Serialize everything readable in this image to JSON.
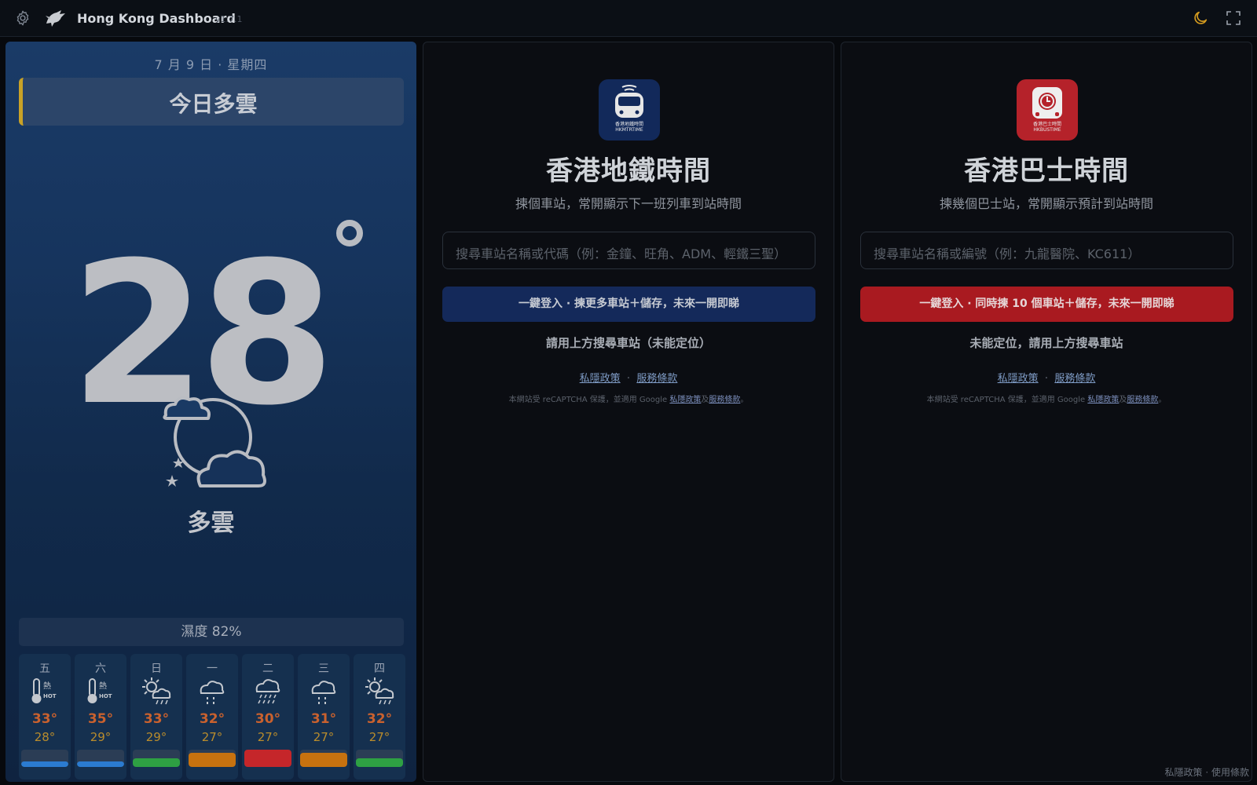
{
  "header": {
    "title": "Hong Kong Dashboard",
    "version": "v1.7.1",
    "icons": [
      "gear-icon",
      "logo-icon",
      "moon-icon",
      "fullscreen-icon"
    ]
  },
  "weather": {
    "date": "7 月 9 日 · 星期四",
    "banner": "今日多雲",
    "temperature": "28",
    "condition": "多雲",
    "condition_icon": "cloudy-night-icon",
    "humidity": "濕度 82%",
    "forecast": [
      {
        "dow": "五",
        "icon": "hot-icon",
        "hi": "33°",
        "lo": "28°",
        "bar_color": "#2b7bd0",
        "bar_level": 0.3
      },
      {
        "dow": "六",
        "icon": "hot-icon",
        "hi": "35°",
        "lo": "29°",
        "bar_color": "#2b7bd0",
        "bar_level": 0.3
      },
      {
        "dow": "日",
        "icon": "sun-shower-icon",
        "hi": "33°",
        "lo": "29°",
        "bar_color": "#2ea043",
        "bar_level": 0.5
      },
      {
        "dow": "一",
        "icon": "shower-icon",
        "hi": "32°",
        "lo": "27°",
        "bar_color": "#c7720f",
        "bar_level": 0.8
      },
      {
        "dow": "二",
        "icon": "heavy-rain-icon",
        "hi": "30°",
        "lo": "27°",
        "bar_color": "#c5262a",
        "bar_level": 1.0
      },
      {
        "dow": "三",
        "icon": "shower-icon",
        "hi": "31°",
        "lo": "27°",
        "bar_color": "#c7720f",
        "bar_level": 0.8
      },
      {
        "dow": "四",
        "icon": "sun-shower-icon",
        "hi": "32°",
        "lo": "27°",
        "bar_color": "#2ea043",
        "bar_level": 0.5
      }
    ]
  },
  "mtr": {
    "icon": "train-icon",
    "icon_caption_1": "香港地鐵時間",
    "icon_caption_2": "HKMTRTIME",
    "title": "香港地鐵時間",
    "subtitle": "揀個車站，常開顯示下一班列車到站時間",
    "search_placeholder": "搜尋車站名稱或代碼（例：金鐘、旺角、ADM、輕鐵三聖）",
    "button": "一鍵登入 · 揀更多車站＋儲存，未來一開即睇",
    "status": "請用上方搜尋車站（未能定位）",
    "privacy": "私隱政策",
    "terms": "服務條款",
    "recaptcha_prefix": "本網站受 reCAPTCHA 保護，並適用 Google ",
    "recaptcha_privacy": "私隱政策",
    "recaptcha_and": "及",
    "recaptcha_terms": "服務條款",
    "recaptcha_suffix": "。"
  },
  "bus": {
    "icon": "bus-clock-icon",
    "icon_caption_1": "香港巴士時間",
    "icon_caption_2": "HKBUSTIME",
    "title": "香港巴士時間",
    "subtitle": "揀幾個巴士站，常開顯示預計到站時間",
    "search_placeholder": "搜尋車站名稱或編號（例：九龍醫院、KC611）",
    "button": "一鍵登入 · 同時揀 10 個車站＋儲存，未來一開即睇",
    "status": "未能定位，請用上方搜尋車站",
    "privacy": "私隱政策",
    "terms": "服務條款",
    "recaptcha_prefix": "本網站受 reCAPTCHA 保護，並適用 Google ",
    "recaptcha_privacy": "私隱政策",
    "recaptcha_and": "及",
    "recaptcha_terms": "服務條款",
    "recaptcha_suffix": "。"
  },
  "footer": {
    "privacy": "私隱政策",
    "sep": "·",
    "terms": "使用條款"
  }
}
